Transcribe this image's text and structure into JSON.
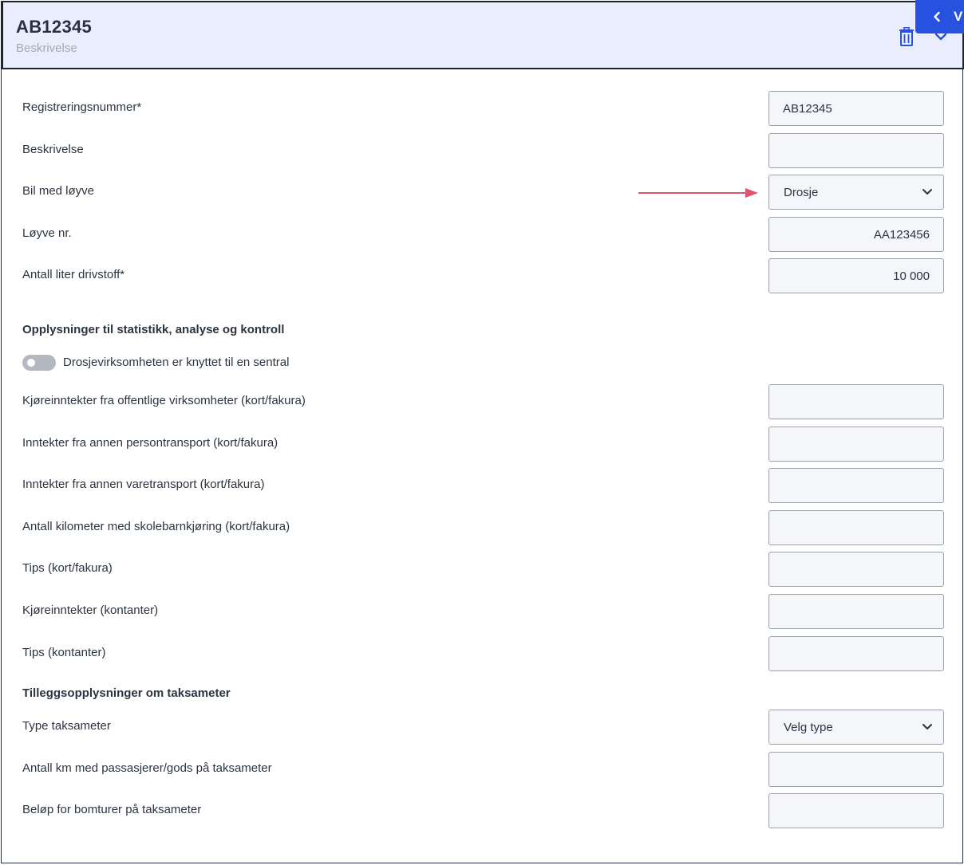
{
  "header": {
    "title": "AB12345",
    "subtitle": "Beskrivelse",
    "side_tab_letter": "V"
  },
  "fields": {
    "registreringsnummer": {
      "label": "Registreringsnummer*",
      "value": "AB12345"
    },
    "beskrivelse": {
      "label": "Beskrivelse",
      "value": ""
    },
    "bil_med_loyve": {
      "label": "Bil med løyve",
      "value": "Drosje"
    },
    "loyve_nr": {
      "label": "Løyve nr.",
      "value": "AA123456"
    },
    "antall_liter": {
      "label": "Antall liter drivstoff*",
      "value": "10 000"
    }
  },
  "stats_section": {
    "title": "Opplysninger til statistikk, analyse og kontroll",
    "toggle_label": "Drosjevirksomheten er knyttet til en sentral",
    "toggle_on": false,
    "rows": [
      {
        "label": "Kjøreinntekter fra offentlige virksomheter (kort/fakura)",
        "value": ""
      },
      {
        "label": "Inntekter fra annen persontransport (kort/fakura)",
        "value": ""
      },
      {
        "label": "Inntekter fra annen varetransport (kort/fakura)",
        "value": ""
      },
      {
        "label": "Antall kilometer med skolebarnkjøring (kort/fakura)",
        "value": ""
      },
      {
        "label": "Tips (kort/fakura)",
        "value": ""
      },
      {
        "label": "Kjøreinntekter (kontanter)",
        "value": ""
      },
      {
        "label": "Tips (kontanter)",
        "value": ""
      }
    ]
  },
  "taximeter_section": {
    "title": "Tilleggsopplysninger om taksameter",
    "type": {
      "label": "Type taksameter",
      "value": "Velg type"
    },
    "km": {
      "label": "Antall km med passasjerer/gods på taksameter",
      "value": ""
    },
    "bomturer": {
      "label": "Beløp for bomturer på taksameter",
      "value": ""
    }
  },
  "colors": {
    "header_bg": "#eaedfc",
    "accent": "#2752e0",
    "arrow": "#e0536a",
    "field_bg": "#f5f6fa"
  },
  "icons": [
    "trash-icon",
    "chevron-left-icon",
    "chevron-down-icon",
    "annotation-arrow-icon"
  ]
}
